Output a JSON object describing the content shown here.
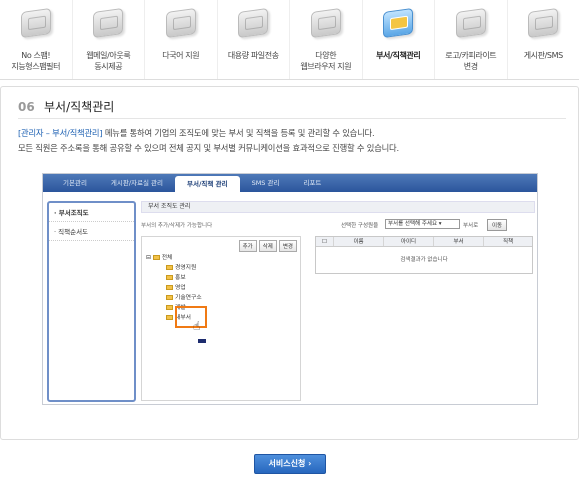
{
  "nav": [
    {
      "label": "No 스팸!\n지능형스팸필터",
      "icon": "spam-filter-icon"
    },
    {
      "label": "웹메일/아웃룩\n동시제공",
      "icon": "webmail-icon"
    },
    {
      "label": "다국어 지원",
      "icon": "multilanguage-icon"
    },
    {
      "label": "대용량 파일전송",
      "icon": "large-file-icon"
    },
    {
      "label": "다양한\n웹브라우저 지원",
      "icon": "browser-icon"
    },
    {
      "label": "부서/직책관리",
      "icon": "department-icon",
      "active": true
    },
    {
      "label": "로고/카피라이트\n변경",
      "icon": "logo-copyright-icon"
    },
    {
      "label": "게시판/SMS",
      "icon": "board-sms-icon"
    }
  ],
  "section": {
    "number": "06",
    "title": "부서/직책관리",
    "desc_highlight": "[관리자 – 부서/직책관리]",
    "desc_rest": " 메뉴를 통하여 기업의 조직도에 맞는 부서 및 직책을 등록 및 관리할 수 있습니다.",
    "desc_line2": "모든 직원은 주소록을 통해 공유할 수 있으며 전체 공지 및 부서별 커뮤니케이션을 효과적으로 진행할 수 있습니다."
  },
  "app": {
    "tabs": [
      "기본관리",
      "게시판/자료실 관리",
      "부서/직책 관리",
      "SMS 관리",
      "리포트"
    ],
    "active_tab": 2,
    "sidebar": [
      "부서조직도",
      "직책순서도"
    ],
    "panel_title": "부서 조직도 관리",
    "hint": "부서의 추가/삭제가 가능합니다",
    "tree_buttons": [
      "추가",
      "삭제",
      "변경"
    ],
    "tree_root": "전체",
    "tree_items": [
      "경영지원",
      "홍보",
      "영업",
      "기술연구소",
      "개발",
      "새부서"
    ],
    "group_label": "선택한 구성원을",
    "select_value": "부서를 선택해 주세요",
    "select_suffix": "부서로",
    "move_button": "이동",
    "grid_columns": [
      "이름",
      "아이디",
      "부서",
      "직책"
    ],
    "grid_empty": "검색결과가 없습니다"
  },
  "service_button": "서비스신청 ›",
  "colors": {
    "accent": "#2767be",
    "highlight": "#f07a14"
  }
}
